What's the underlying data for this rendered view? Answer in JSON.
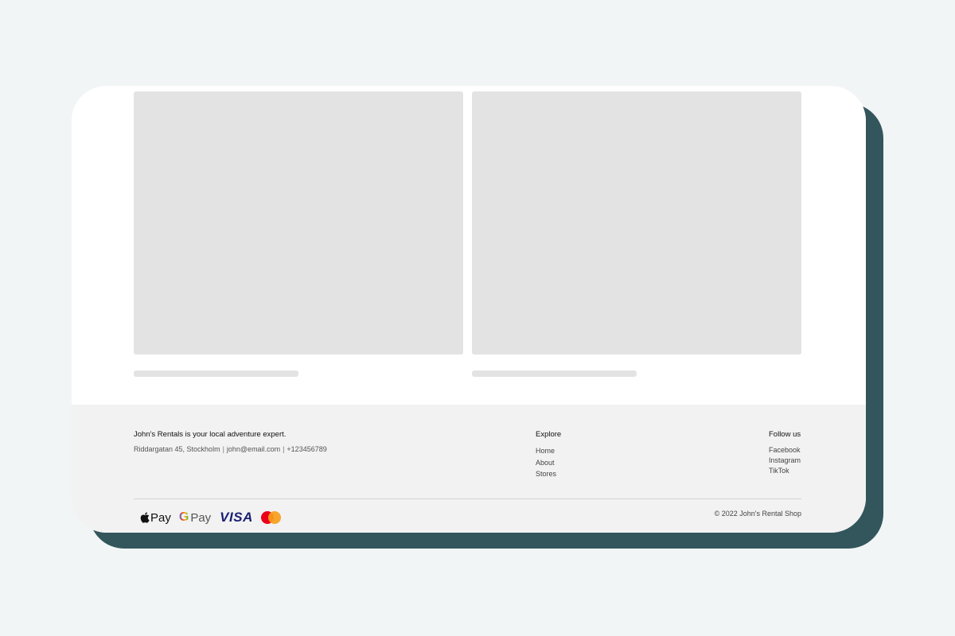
{
  "footer": {
    "tagline": "John's Rentals is your local adventure expert.",
    "contact": {
      "address": "Riddargatan 45, Stockholm",
      "email": "john@email.com",
      "phone": "+123456789",
      "separator": "|"
    },
    "explore": {
      "heading": "Explore",
      "links": [
        "Home",
        "About",
        "Stores"
      ]
    },
    "follow": {
      "heading": "Follow us",
      "links": [
        "Facebook",
        "Instagram",
        "TikTok"
      ]
    },
    "payments": {
      "apple_pay": "Pay",
      "google_pay_g": "G",
      "google_pay": "Pay",
      "visa": "VISA"
    },
    "copyright": "© 2022 John's Rental Shop"
  },
  "icons": {
    "apple": "apple-icon",
    "google": "google-icon",
    "visa": "visa-icon",
    "mastercard": "mastercard-icon"
  },
  "colors": {
    "background": "#f1f5f6",
    "card": "#ffffff",
    "card_shadow": "#33565c",
    "footer": "#f2f2f2",
    "placeholder": "#e3e3e3",
    "visa": "#1a1f71",
    "mastercard_red": "#eb001b",
    "mastercard_yellow": "#f79e1b"
  }
}
